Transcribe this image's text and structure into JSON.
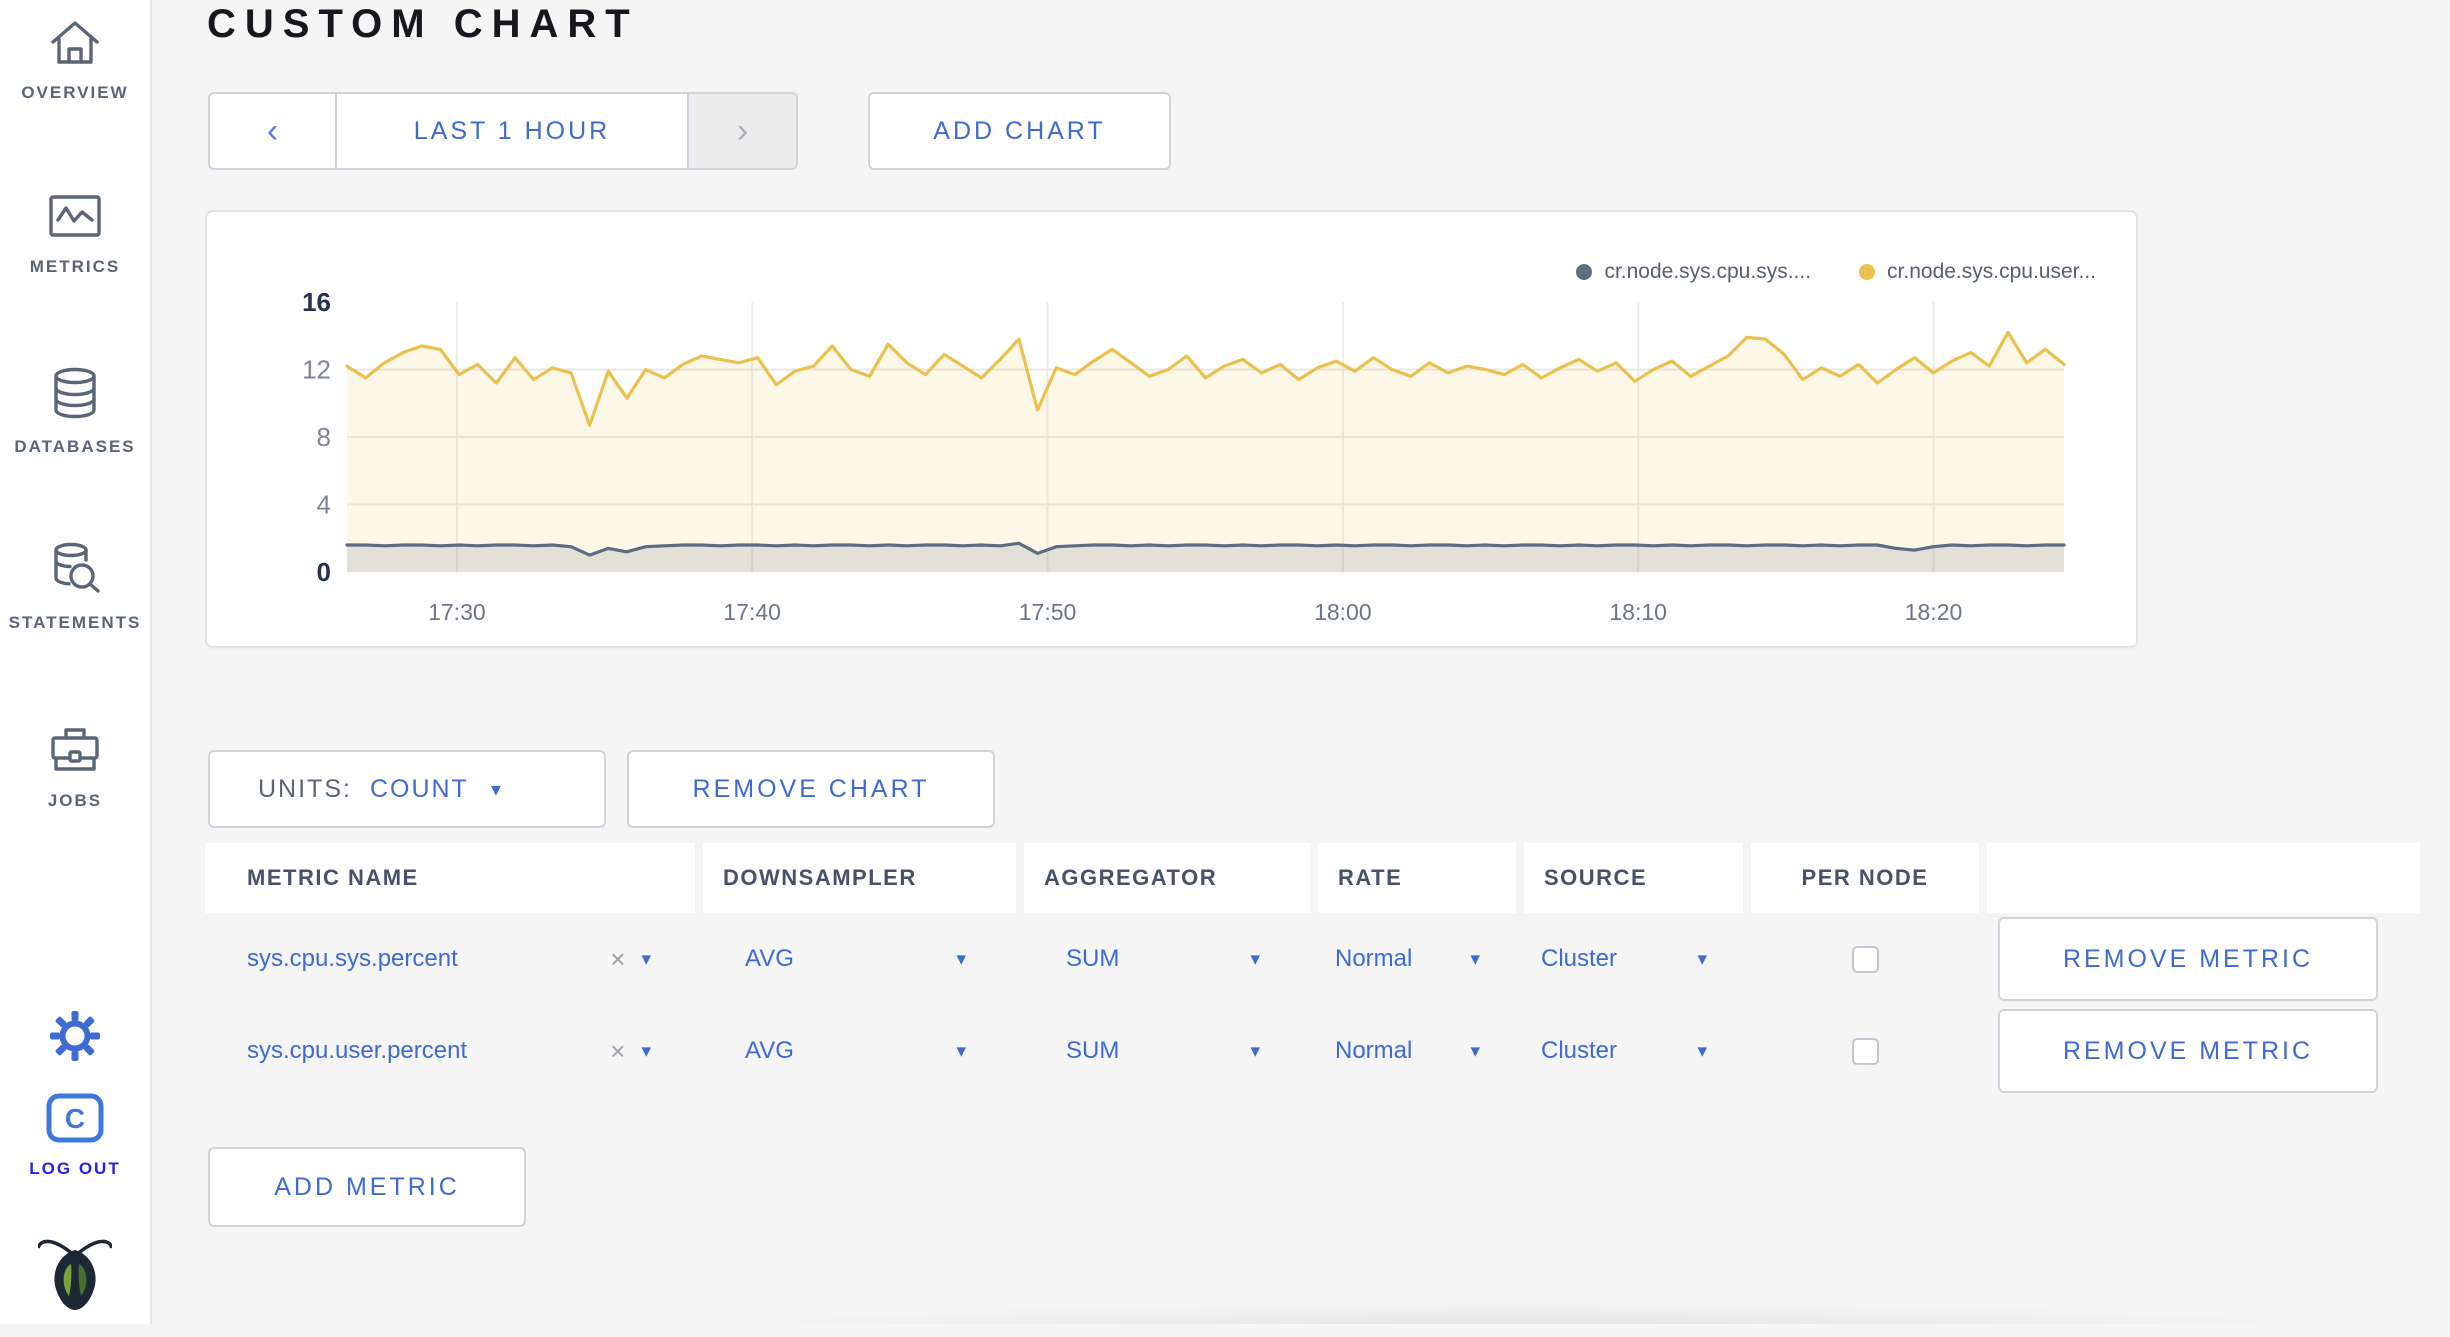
{
  "page": {
    "title": "CUSTOM CHART"
  },
  "glyphs": {
    "prev": "‹",
    "next": "›",
    "caret": "▾",
    "close": "×"
  },
  "colors": {
    "accent_blue": "#3e6ad3",
    "logout_blue": "#2226e2",
    "sidebar_gray": "#5a6577"
  },
  "sidebar": {
    "items": [
      {
        "label": "OVERVIEW",
        "icon": "home-icon"
      },
      {
        "label": "METRICS",
        "icon": "metrics-icon"
      },
      {
        "label": "DATABASES",
        "icon": "database-icon"
      },
      {
        "label": "STATEMENTS",
        "icon": "statements-icon"
      },
      {
        "label": "JOBS",
        "icon": "briefcase-icon"
      }
    ],
    "logout_label": "LOG OUT",
    "logout_monogram": "C"
  },
  "toolbar": {
    "time_label": "LAST 1 HOUR",
    "add_chart_label": "ADD CHART"
  },
  "controls": {
    "units_label": "UNITS:",
    "units_value": "COUNT",
    "remove_chart_label": "REMOVE CHART",
    "add_metric_label": "ADD METRIC"
  },
  "chart_data": {
    "type": "line",
    "title": "",
    "xlabel": "",
    "ylabel": "",
    "ylim": [
      0,
      16
    ],
    "y_ticks": [
      0,
      4,
      8,
      12,
      16
    ],
    "y_gridlines": [
      4,
      8,
      12
    ],
    "grid": true,
    "legend_position": "top-right",
    "x_ticks": [
      {
        "label": "17:30",
        "frac": 0.064
      },
      {
        "label": "17:40",
        "frac": 0.236
      },
      {
        "label": "17:50",
        "frac": 0.408
      },
      {
        "label": "18:00",
        "frac": 0.58
      },
      {
        "label": "18:10",
        "frac": 0.752
      },
      {
        "label": "18:20",
        "frac": 0.924
      }
    ],
    "series": [
      {
        "name": "cr.node.sys.cpu.user...",
        "color": "#ecc04c",
        "fill": "rgba(236,192,76,0.13)",
        "values": [
          12.2,
          11.5,
          12.4,
          13.0,
          13.4,
          13.2,
          11.7,
          12.3,
          11.2,
          12.7,
          11.4,
          12.1,
          11.8,
          8.7,
          11.9,
          10.3,
          12.0,
          11.5,
          12.3,
          12.8,
          12.6,
          12.4,
          12.7,
          11.1,
          11.9,
          12.2,
          13.4,
          12.0,
          11.6,
          13.5,
          12.4,
          11.7,
          12.9,
          12.2,
          11.5,
          12.6,
          13.8,
          9.6,
          12.1,
          11.7,
          12.5,
          13.2,
          12.4,
          11.6,
          12.0,
          12.8,
          11.5,
          12.2,
          12.6,
          11.8,
          12.3,
          11.4,
          12.1,
          12.5,
          11.9,
          12.7,
          12.0,
          11.6,
          12.4,
          11.8,
          12.2,
          12.0,
          11.7,
          12.3,
          11.5,
          12.1,
          12.6,
          11.9,
          12.4,
          11.3,
          12.0,
          12.5,
          11.6,
          12.2,
          12.8,
          13.9,
          13.8,
          12.9,
          11.4,
          12.1,
          11.6,
          12.3,
          11.2,
          12.0,
          12.7,
          11.8,
          12.5,
          13.0,
          12.2,
          14.2,
          12.4,
          13.2,
          12.3
        ]
      },
      {
        "name": "cr.node.sys.cpu.sys....",
        "color": "#5f6b80",
        "fill": "rgba(95,107,128,0.16)",
        "values": [
          1.6,
          1.6,
          1.55,
          1.6,
          1.6,
          1.55,
          1.6,
          1.55,
          1.6,
          1.6,
          1.55,
          1.6,
          1.5,
          1.0,
          1.4,
          1.2,
          1.5,
          1.55,
          1.6,
          1.6,
          1.55,
          1.6,
          1.6,
          1.55,
          1.6,
          1.55,
          1.6,
          1.6,
          1.55,
          1.6,
          1.55,
          1.6,
          1.6,
          1.55,
          1.6,
          1.55,
          1.7,
          1.1,
          1.5,
          1.55,
          1.6,
          1.6,
          1.55,
          1.6,
          1.55,
          1.6,
          1.6,
          1.55,
          1.6,
          1.55,
          1.6,
          1.6,
          1.55,
          1.6,
          1.55,
          1.6,
          1.6,
          1.55,
          1.6,
          1.6,
          1.55,
          1.6,
          1.55,
          1.6,
          1.6,
          1.55,
          1.6,
          1.55,
          1.6,
          1.6,
          1.55,
          1.6,
          1.55,
          1.6,
          1.6,
          1.55,
          1.6,
          1.6,
          1.55,
          1.6,
          1.55,
          1.6,
          1.6,
          1.4,
          1.3,
          1.5,
          1.6,
          1.55,
          1.6,
          1.6,
          1.55,
          1.6,
          1.6
        ]
      }
    ],
    "legend_order": [
      "cr.node.sys.cpu.sys....",
      "cr.node.sys.cpu.user..."
    ],
    "legend_colors": {
      "cr.node.sys.cpu.sys....": "#5f6b80",
      "cr.node.sys.cpu.user...": "#ecc04c"
    }
  },
  "table": {
    "headers": [
      "METRIC NAME",
      "DOWNSAMPLER",
      "AGGREGATOR",
      "RATE",
      "SOURCE",
      "PER NODE",
      ""
    ],
    "rows": [
      {
        "metric_name": "sys.cpu.sys.percent",
        "downsampler": "AVG",
        "aggregator": "SUM",
        "rate": "Normal",
        "source": "Cluster",
        "per_node_checked": false,
        "remove_label": "REMOVE METRIC"
      },
      {
        "metric_name": "sys.cpu.user.percent",
        "downsampler": "AVG",
        "aggregator": "SUM",
        "rate": "Normal",
        "source": "Cluster",
        "per_node_checked": false,
        "remove_label": "REMOVE METRIC"
      }
    ]
  }
}
